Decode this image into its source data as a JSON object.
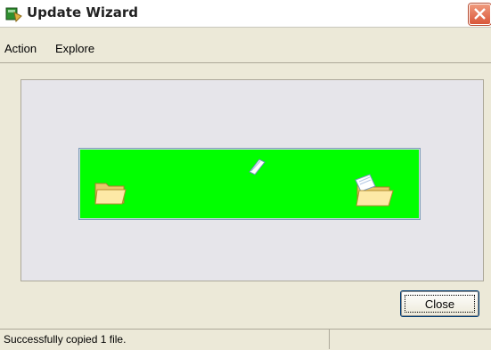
{
  "window": {
    "title": "Update Wizard"
  },
  "menu": {
    "items": [
      "Action",
      "Explore"
    ]
  },
  "buttons": {
    "close_label": "Close"
  },
  "status": {
    "text": "Successfully copied 1 file."
  },
  "animation": {
    "background_color": "#01ff00"
  },
  "icons": {
    "app": "update-wizard-icon",
    "source_folder": "folder-icon",
    "dest_folder": "folder-with-document-icon",
    "flying_document": "flying-document-icon"
  }
}
